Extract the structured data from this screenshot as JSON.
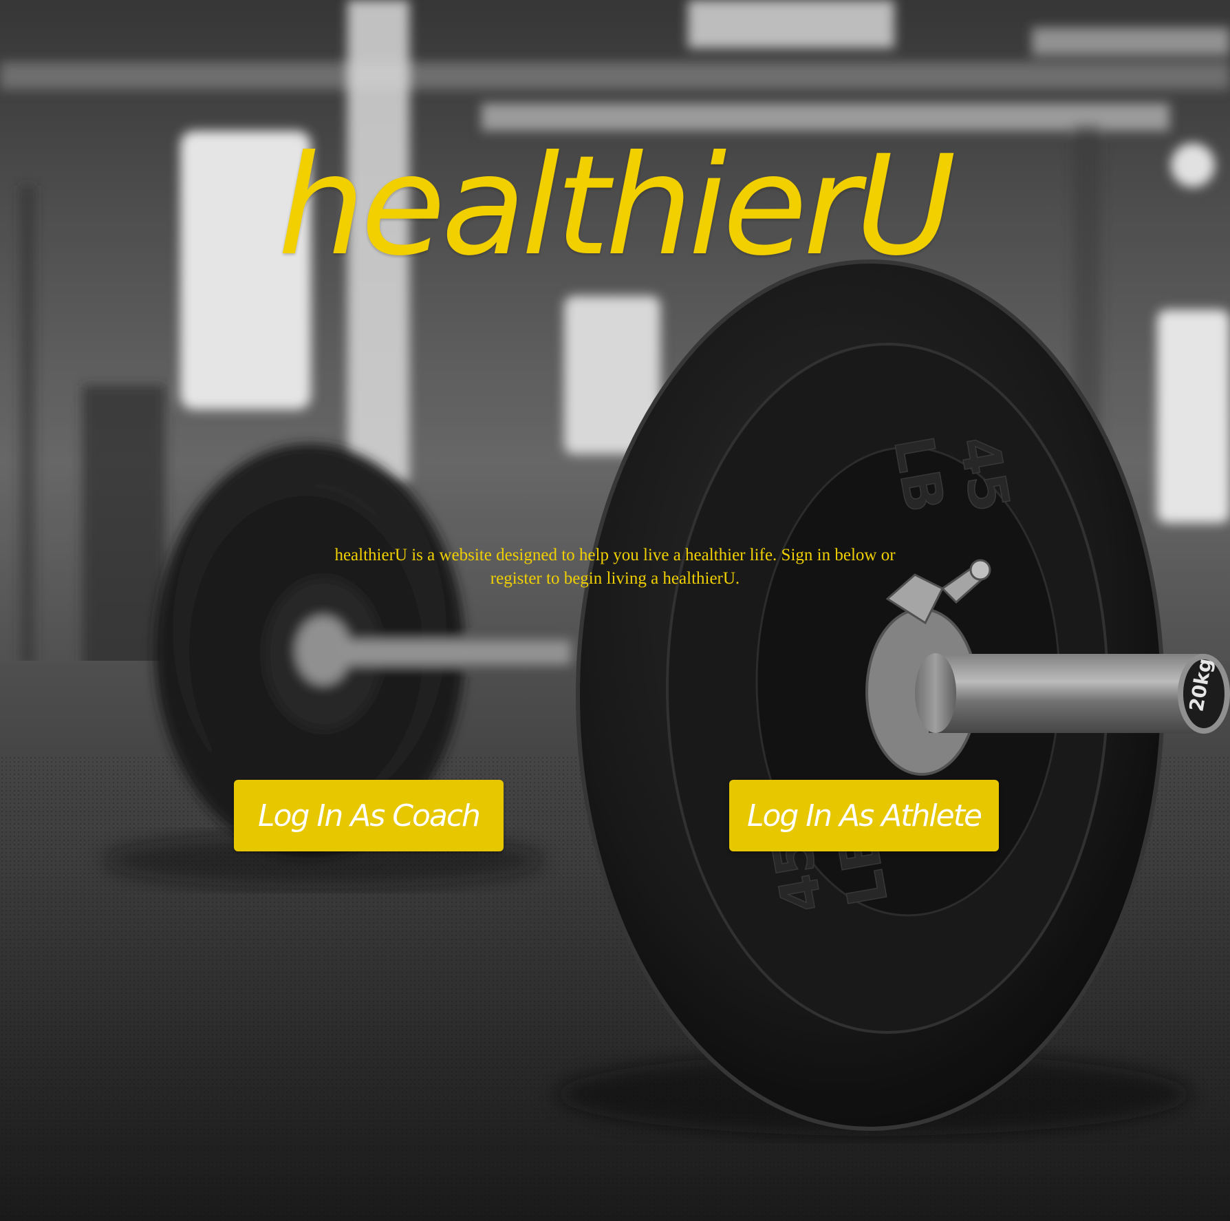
{
  "app": {
    "title": "healthierU",
    "tagline": "healthierU is a website designed to help you live a healthier life. Sign in below or register to begin living a healthierU."
  },
  "buttons": {
    "coach_label": "Log In As Coach",
    "athlete_label": "Log In As Athlete"
  },
  "background": {
    "plate_large_weight": "45",
    "plate_large_unit": "LB",
    "bar_end_label": "20kg"
  },
  "colors": {
    "brand_yellow": "#f2d000",
    "button_yellow": "#e6c700",
    "button_text": "#ffffff"
  }
}
